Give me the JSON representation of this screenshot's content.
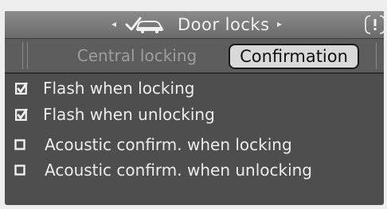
{
  "header": {
    "left_arrow": "◂",
    "right_arrow": "▸",
    "icon": "door-lock-check-icon",
    "title": "Door locks",
    "info_icon": "info-icon"
  },
  "tabs": [
    {
      "label": "Central locking",
      "active": false
    },
    {
      "label": "Confirmation",
      "active": true
    }
  ],
  "options": [
    {
      "label": "Flash when locking",
      "checked": true
    },
    {
      "label": "Flash when unlocking",
      "checked": true
    },
    {
      "label": "Acoustic confirm. when locking",
      "checked": false
    },
    {
      "label": "Acoustic confirm. when unlocking",
      "checked": false
    }
  ],
  "colors": {
    "panel": "#4e4e4e",
    "header": "#7a7a7a",
    "active_tab": "#d9d9d9",
    "text": "#ececec"
  }
}
